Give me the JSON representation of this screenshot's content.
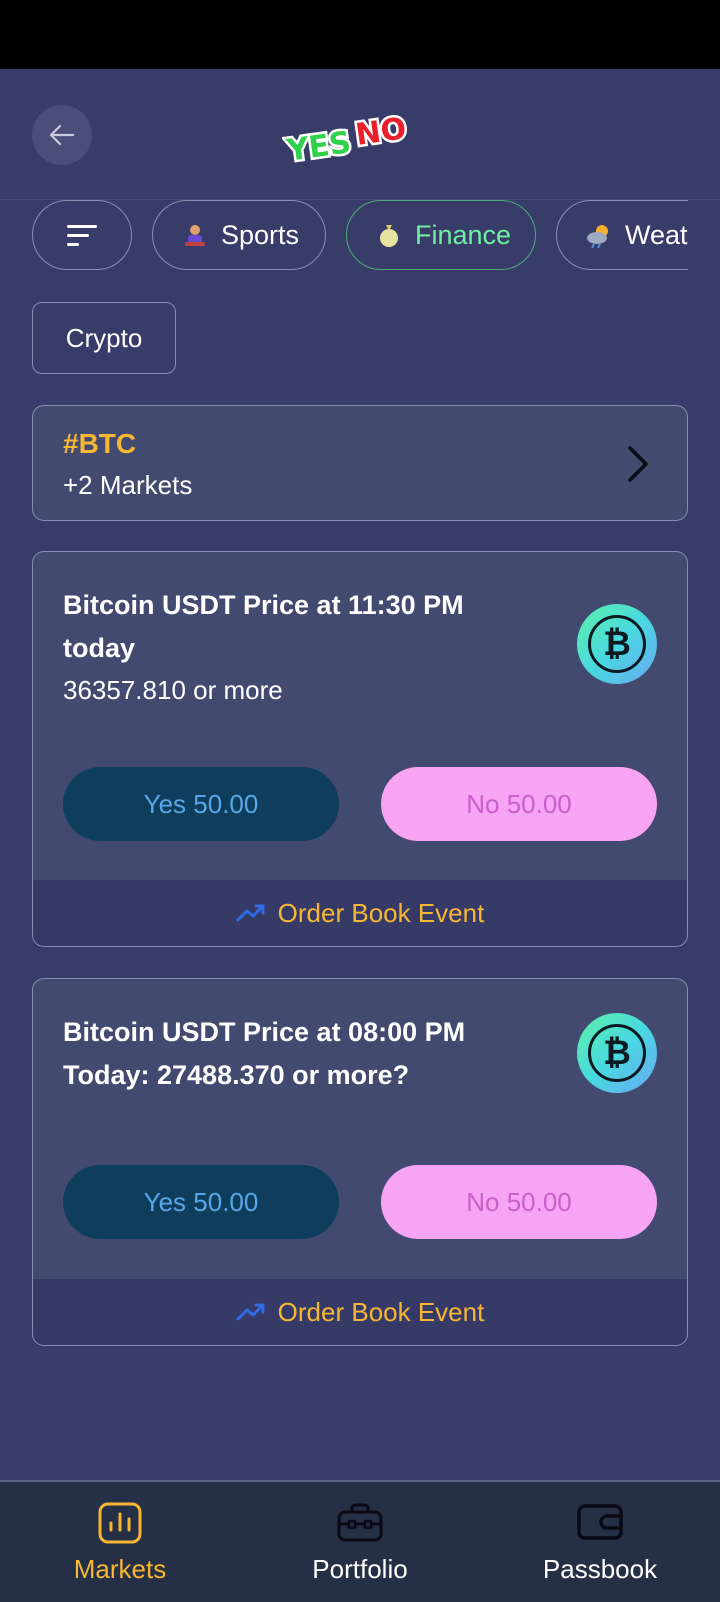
{
  "app": {
    "logo_text": "YESNO"
  },
  "categories": [
    {
      "label": "Sports",
      "icon": "sports-emoji-icon",
      "active": false
    },
    {
      "label": "Finance",
      "icon": "money-bag-icon",
      "active": true
    },
    {
      "label": "Weatl",
      "icon": "weather-icon",
      "active": false
    }
  ],
  "sub_category": {
    "label": "Crypto"
  },
  "tag_card": {
    "title": "#BTC",
    "subtitle": "+2 Markets"
  },
  "markets": [
    {
      "title": "Bitcoin USDT Price at 11:30 PM today",
      "subtitle": "36357.810 or more",
      "yes_label": "Yes 50.00",
      "no_label": "No 50.00",
      "footer_label": "Order Book Event",
      "icon": "bitcoin-icon"
    },
    {
      "title": "Bitcoin USDT Price at 08:00 PM Today: 27488.370 or more?",
      "subtitle": "",
      "yes_label": "Yes 50.00",
      "no_label": "No 50.00",
      "footer_label": "Order Book Event",
      "icon": "bitcoin-icon"
    }
  ],
  "bottom_nav": [
    {
      "label": "Markets",
      "icon": "bar-chart-icon",
      "active": true
    },
    {
      "label": "Portfolio",
      "icon": "briefcase-icon",
      "active": false
    },
    {
      "label": "Passbook",
      "icon": "wallet-icon",
      "active": false
    }
  ],
  "colors": {
    "background": "#383c68",
    "accent": "#f7b733",
    "active_chip": "#6ff0a0",
    "yes_button": "#0f3e5c",
    "no_button": "#f7a4f4"
  }
}
